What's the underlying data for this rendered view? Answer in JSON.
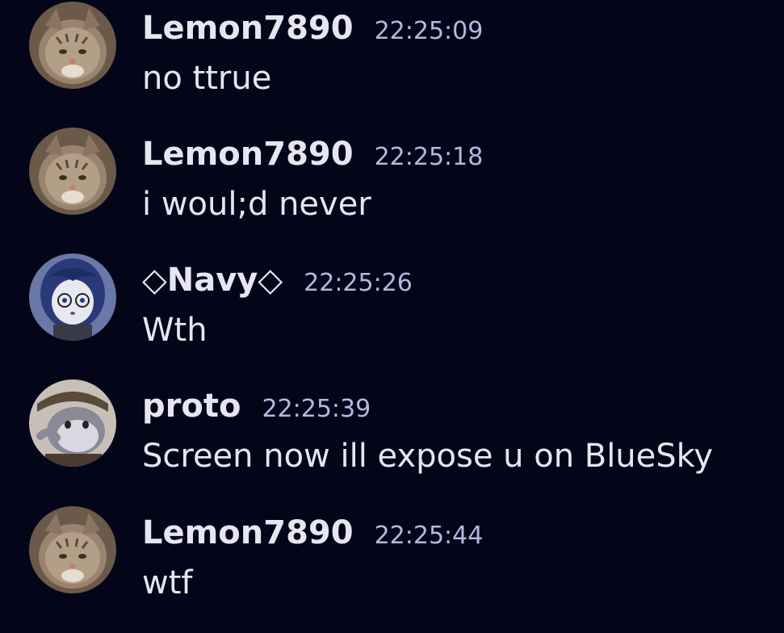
{
  "messages": [
    {
      "username": "Lemon7890",
      "timestamp": "22:25:09",
      "text": "no ttrue",
      "avatar_icon": "cat-avatar"
    },
    {
      "username": "Lemon7890",
      "timestamp": "22:25:18",
      "text": "i woul;d never",
      "avatar_icon": "cat-avatar"
    },
    {
      "username": "◇Navy◇",
      "timestamp": "22:25:26",
      "text": "Wth",
      "avatar_icon": "anime-girl-avatar"
    },
    {
      "username": "proto",
      "timestamp": "22:25:39",
      "text": "Screen now ill expose u on BlueSky",
      "avatar_icon": "cartoon-creature-avatar"
    },
    {
      "username": "Lemon7890",
      "timestamp": "22:25:44",
      "text": "wtf",
      "avatar_icon": "cat-avatar"
    }
  ],
  "colors": {
    "background": "#05051a",
    "username": "#e6e6f0",
    "timestamp": "#b9b6de",
    "text": "#e6e6f0"
  }
}
